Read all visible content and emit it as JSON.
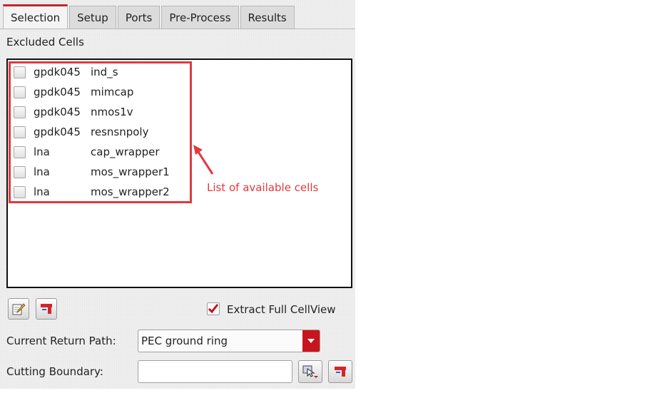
{
  "tabs": [
    {
      "label": "Selection",
      "active": true
    },
    {
      "label": "Setup",
      "active": false
    },
    {
      "label": "Ports",
      "active": false
    },
    {
      "label": "Pre-Process",
      "active": false
    },
    {
      "label": "Results",
      "active": false
    }
  ],
  "excluded_cells": {
    "label": "Excluded Cells",
    "rows": [
      {
        "library": "gpdk045",
        "cell": "ind_s",
        "checked": false
      },
      {
        "library": "gpdk045",
        "cell": "mimcap",
        "checked": false
      },
      {
        "library": "gpdk045",
        "cell": "nmos1v",
        "checked": false
      },
      {
        "library": "gpdk045",
        "cell": "resnsnpoly",
        "checked": false
      },
      {
        "library": "lna",
        "cell": "cap_wrapper",
        "checked": false
      },
      {
        "library": "lna",
        "cell": "mos_wrapper1",
        "checked": false
      },
      {
        "library": "lna",
        "cell": "mos_wrapper2",
        "checked": false
      }
    ]
  },
  "annotation": {
    "text": "List of available cells",
    "color": "#e03a3e"
  },
  "toolbar": {
    "edit_icon": "edit-pencil-icon",
    "clear_icon": "clear-red-icon"
  },
  "extract_full_cellview": {
    "label": "Extract Full CellView",
    "checked": true
  },
  "return_path": {
    "label": "Current Return Path:",
    "value": "PEC ground ring"
  },
  "cutting_boundary": {
    "label": "Cutting Boundary:",
    "value": ""
  },
  "colors": {
    "accent": "#c0282d",
    "dropdown": "#c8141c",
    "check": "#c0141c"
  }
}
